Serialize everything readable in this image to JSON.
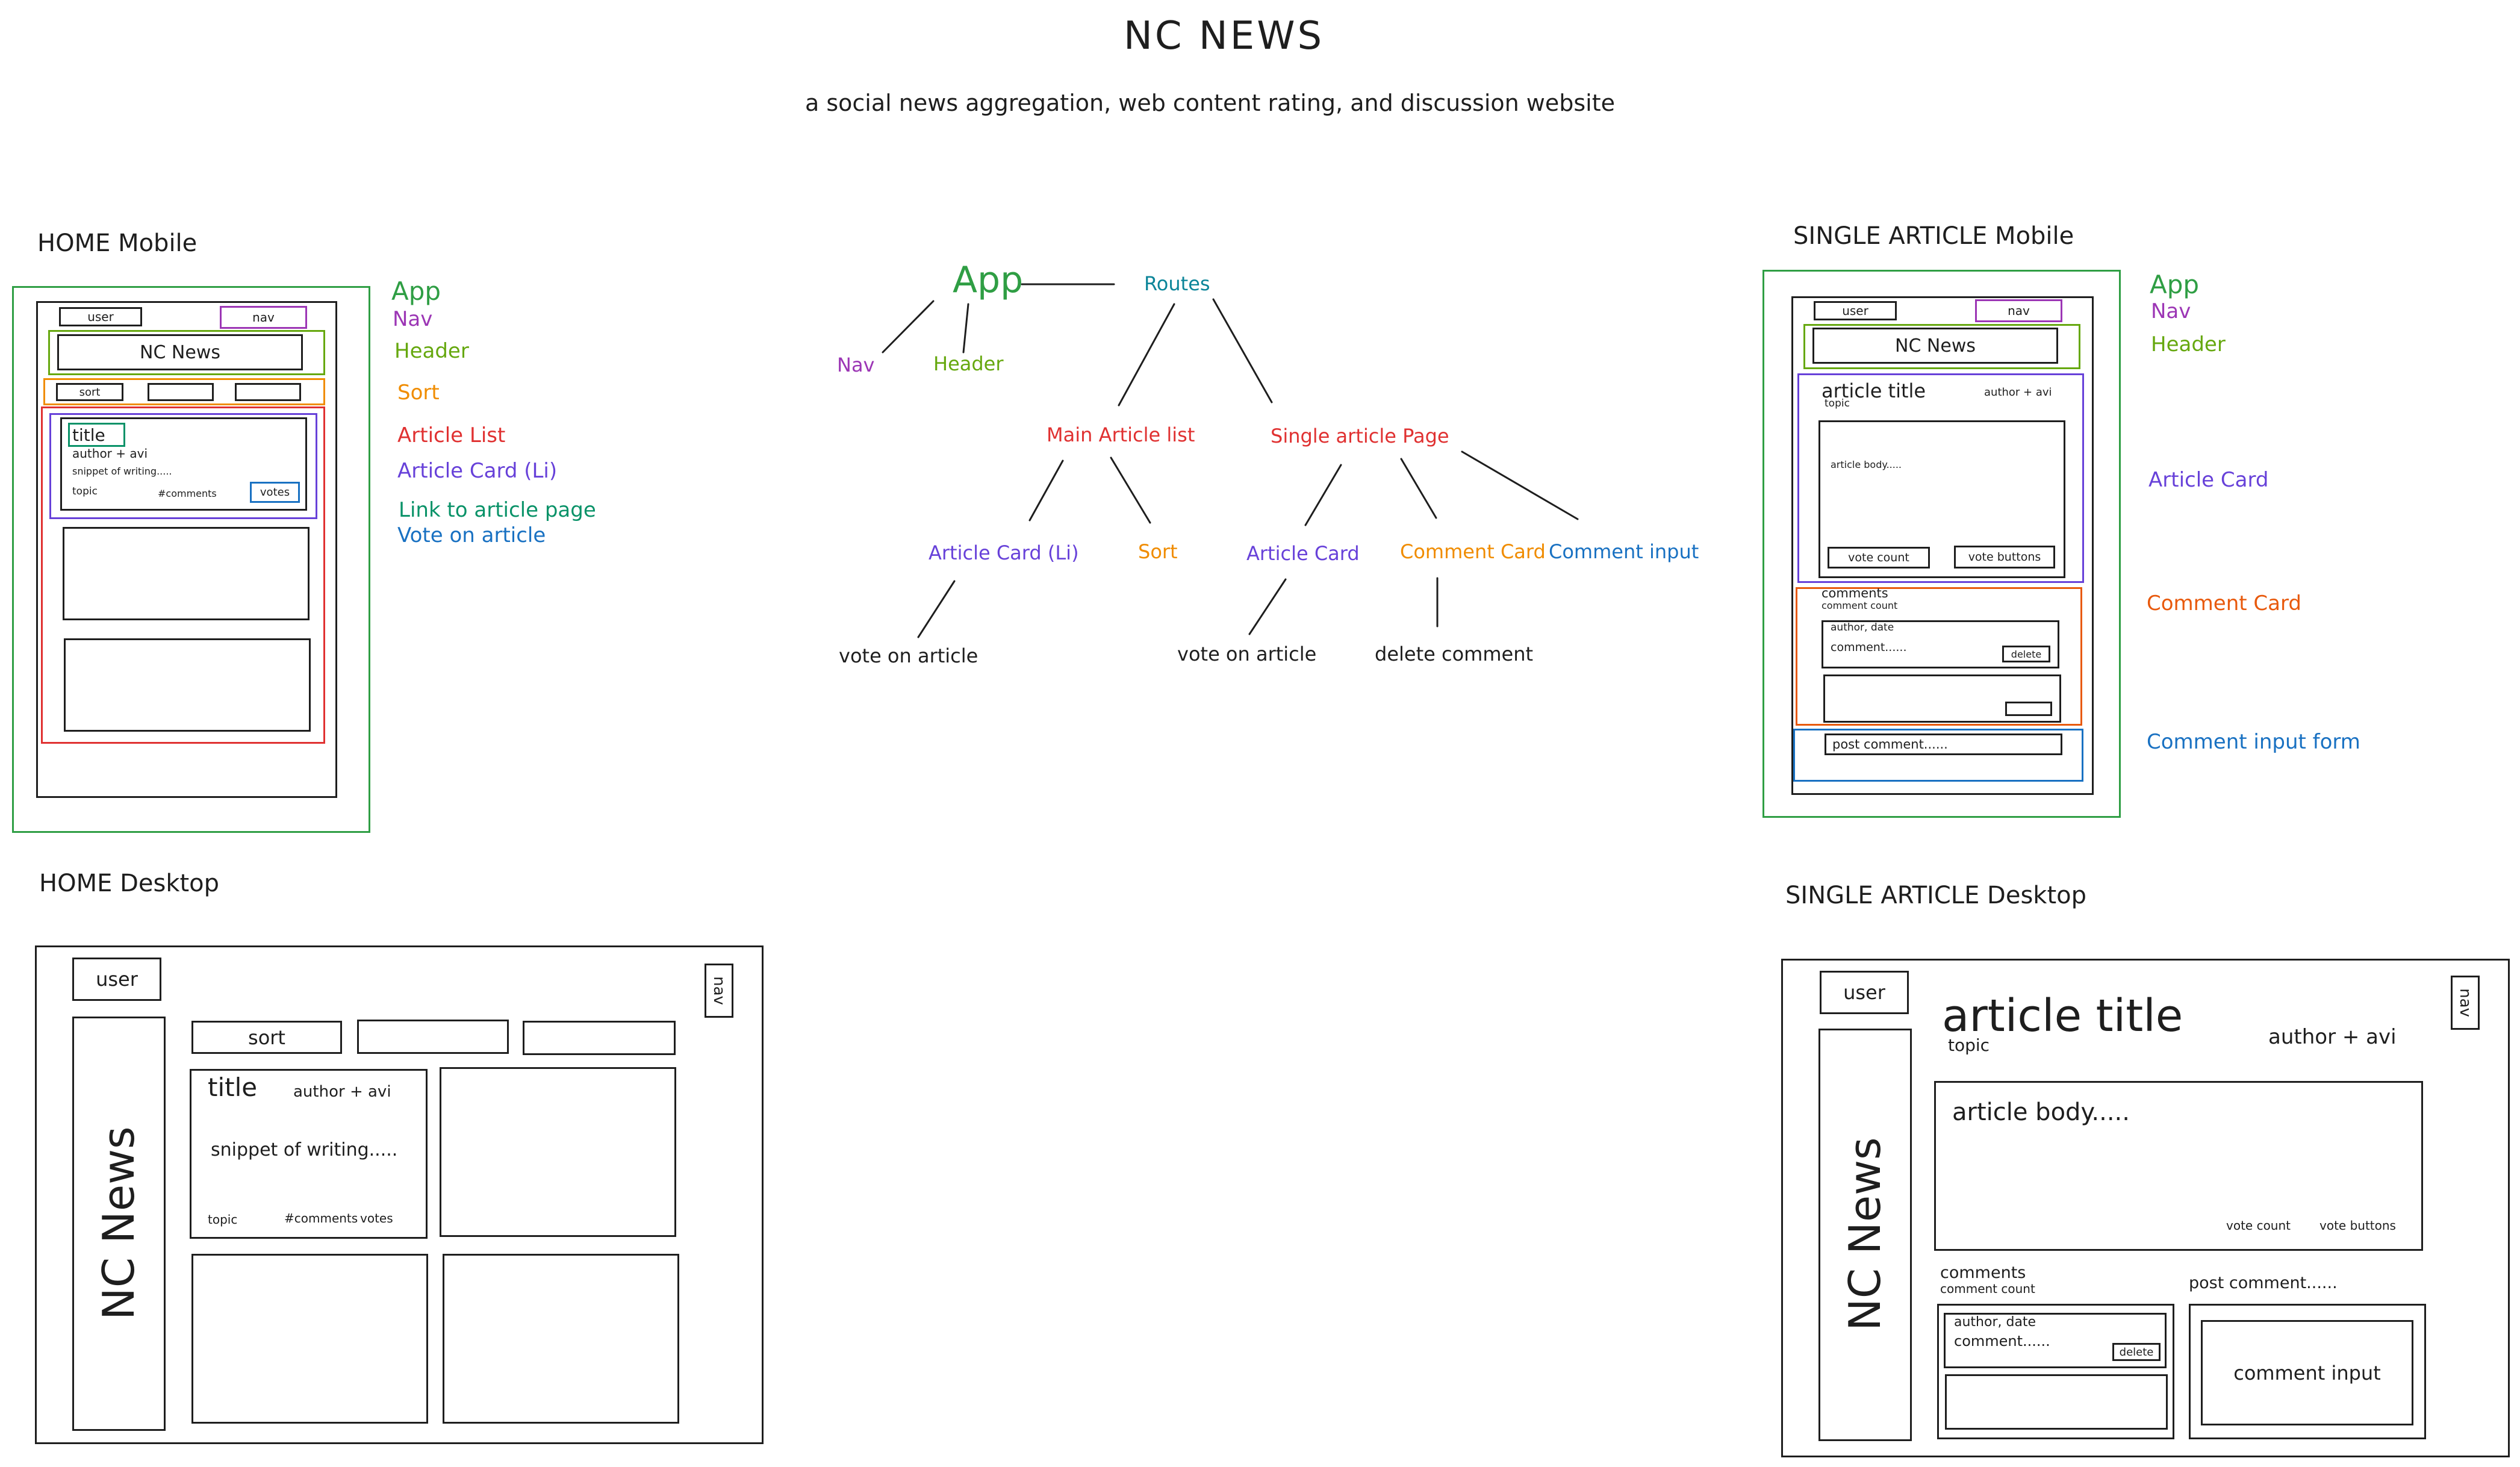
{
  "header": {
    "title": "NC NEWS",
    "subtitle": "a social news aggregation, web content rating, and discussion website"
  },
  "colors": {
    "app": "#2f9e44",
    "nav": "#9c36b5",
    "header": "#66a80f",
    "sort": "#f08c00",
    "article_list": "#e03131",
    "article_card": "#6741d9",
    "link": "#099268",
    "vote": "#1971c2",
    "routes": "#0c8599",
    "comment_card": "#e8590c",
    "comment_input": "#1971c2",
    "ink": "#1e1e1e"
  },
  "home_mobile": {
    "heading": "HOME Mobile",
    "user": "user",
    "nav": "nav",
    "brand": "NC News",
    "sort": "sort",
    "card_title": "title",
    "card_author": "author + avi",
    "card_snippet": "snippet of writing.....",
    "card_topic": "topic",
    "card_comments": "#comments",
    "card_votes": "votes",
    "legend": [
      "App",
      "Nav",
      "Header",
      "Sort",
      "Article List",
      "Article Card (Li)",
      "Link to article page",
      "Vote on article"
    ]
  },
  "tree": {
    "app": "App",
    "routes": "Routes",
    "nav": "Nav",
    "header": "Header",
    "main_list": "Main Article list",
    "single_page": "Single article Page",
    "article_card_li": "Article Card (Li)",
    "sort": "Sort",
    "article_card": "Article Card",
    "comment_card": "Comment Card",
    "comment_input": "Comment input",
    "vote1": "vote on article",
    "vote2": "vote on article",
    "delete_comment": "delete comment"
  },
  "single_mobile": {
    "heading": "SINGLE ARTICLE Mobile",
    "user": "user",
    "nav": "nav",
    "brand": "NC News",
    "article_title": "article title",
    "author": "author + avi",
    "topic": "topic",
    "body": "article body.....",
    "vote_count": "vote count",
    "vote_buttons": "vote buttons",
    "comments": "comments",
    "comment_count": "comment count",
    "author_date": "author, date",
    "comment": "comment......",
    "delete": "delete",
    "post_comment": "post comment......",
    "legend": [
      "App",
      "Nav",
      "Header",
      "Article Card",
      "Comment Card",
      "Comment input form"
    ]
  },
  "home_desktop": {
    "heading": "HOME Desktop",
    "user": "user",
    "nav": "nav",
    "brand": "NC News",
    "sort": "sort",
    "card_title": "title",
    "card_author": "author + avi",
    "card_snippet": "snippet of writing.....",
    "card_topic": "topic",
    "card_comments": "#comments",
    "card_votes": "votes"
  },
  "single_desktop": {
    "heading": "SINGLE ARTICLE Desktop",
    "user": "user",
    "nav": "nav",
    "brand": "NC News",
    "article_title": "article title",
    "author": "author + avi",
    "topic": "topic",
    "body": "article body.....",
    "vote_count": "vote count",
    "vote_buttons": "vote buttons",
    "comments": "comments",
    "comment_count": "comment count",
    "post_comment": "post comment......",
    "author_date": "author, date",
    "comment": "comment......",
    "delete": "delete",
    "comment_input": "comment input"
  }
}
